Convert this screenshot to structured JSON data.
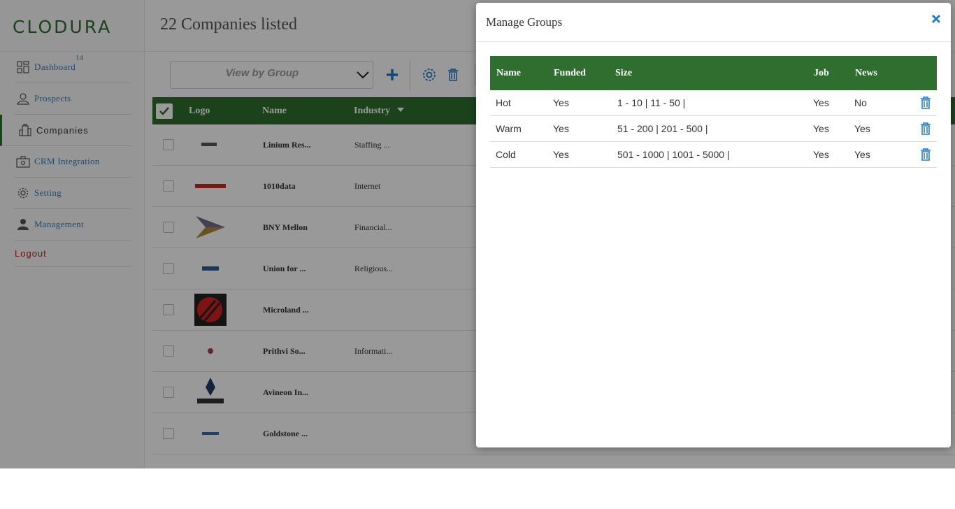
{
  "app": {
    "logo": "CLODURA"
  },
  "sidebar": {
    "items": [
      {
        "label": "Dashboard",
        "badge": "14",
        "icon": "dashboard-icon"
      },
      {
        "label": "Prospects",
        "icon": "user-icon"
      },
      {
        "label": "Companies",
        "icon": "building-icon",
        "active": true
      },
      {
        "label": "CRM Integration",
        "icon": "crm-icon"
      },
      {
        "label": "Setting",
        "icon": "gear-icon"
      },
      {
        "label": "Management",
        "icon": "person-icon"
      }
    ],
    "logout": "Logout"
  },
  "main": {
    "title": "22 Companies listed",
    "group_select": {
      "selected": "View by Group"
    },
    "table": {
      "columns": [
        "Logo",
        "Name",
        "Industry"
      ],
      "rows": [
        {
          "logo": "linium-logo",
          "name": "Linium Res...",
          "industry": "Staffing ..."
        },
        {
          "logo": "1010data-logo",
          "name": "1010data",
          "industry": "Internet"
        },
        {
          "logo": "bny-mellon-logo",
          "name": "BNY Mellon",
          "industry": "Financial..."
        },
        {
          "logo": "union-logo",
          "name": "Union for ...",
          "industry": "Religious..."
        },
        {
          "logo": "microland-logo",
          "name": "Microland ...",
          "industry": ""
        },
        {
          "logo": "prithvi-logo",
          "name": "Prithvi So...",
          "industry": "Informati..."
        },
        {
          "logo": "avineon-logo",
          "name": "Avineon In...",
          "industry": ""
        },
        {
          "logo": "goldstone-logo",
          "name": "Goldstone ...",
          "industry": ""
        }
      ]
    }
  },
  "modal": {
    "title": "Manage Groups",
    "columns": {
      "name": "Name",
      "funded": "Funded",
      "size": "Size",
      "job": "Job",
      "news": "News"
    },
    "rows": [
      {
        "name": "Hot",
        "funded": "Yes",
        "size": "1 - 10 | 11 - 50 |",
        "job": "Yes",
        "news": "No"
      },
      {
        "name": "Warm",
        "funded": "Yes",
        "size": "51 - 200 | 201 - 500 |",
        "job": "Yes",
        "news": "Yes"
      },
      {
        "name": "Cold",
        "funded": "Yes",
        "size": "501 - 1000 | 1001 - 5000 |",
        "job": "Yes",
        "news": "Yes"
      }
    ]
  },
  "colors": {
    "brand_green": "#2f6e2f",
    "link_blue": "#3a7ab5",
    "logout_red": "#b32020",
    "icon_blue": "#1e7bc4"
  }
}
